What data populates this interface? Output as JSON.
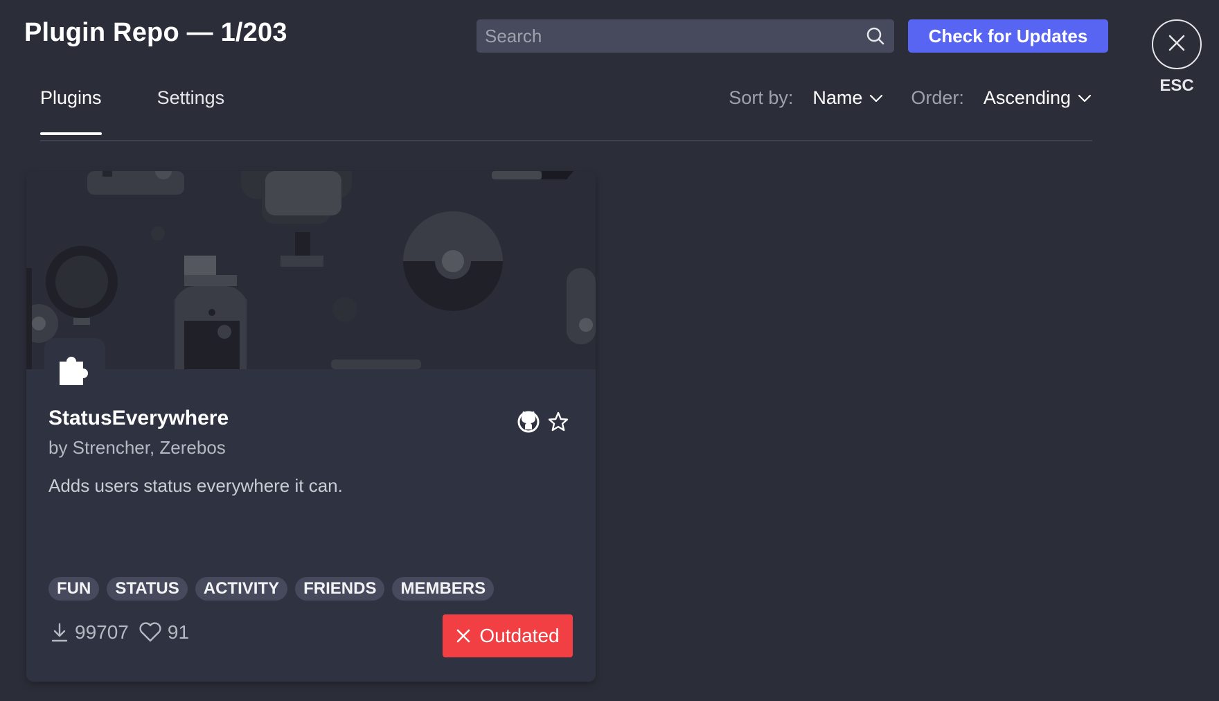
{
  "header": {
    "title": "Plugin Repo — 1/203",
    "search_placeholder": "Search",
    "check_updates_label": "Check for Updates",
    "esc_label": "ESC"
  },
  "tabs": [
    {
      "label": "Plugins",
      "active": true
    },
    {
      "label": "Settings",
      "active": false
    }
  ],
  "sort": {
    "sort_by_label": "Sort by:",
    "sort_by_value": "Name",
    "order_label": "Order:",
    "order_value": "Ascending"
  },
  "plugin": {
    "name": "StatusEverywhere",
    "author": "by Strencher, Zerebos",
    "description": "Adds users status everywhere it can.",
    "tags": [
      "FUN",
      "STATUS",
      "ACTIVITY",
      "FRIENDS",
      "MEMBERS"
    ],
    "downloads": "99707",
    "likes": "91",
    "status_label": "Outdated"
  },
  "colors": {
    "background": "#2b2d38",
    "card": "#2f3241",
    "accent": "#5865f2",
    "danger": "#f23f43",
    "tag_bg": "#474a5c"
  },
  "icons": [
    "search-icon",
    "close-icon",
    "chevron-down-icon",
    "puzzle-icon",
    "github-icon",
    "star-icon",
    "download-icon",
    "heart-icon",
    "x-icon"
  ]
}
